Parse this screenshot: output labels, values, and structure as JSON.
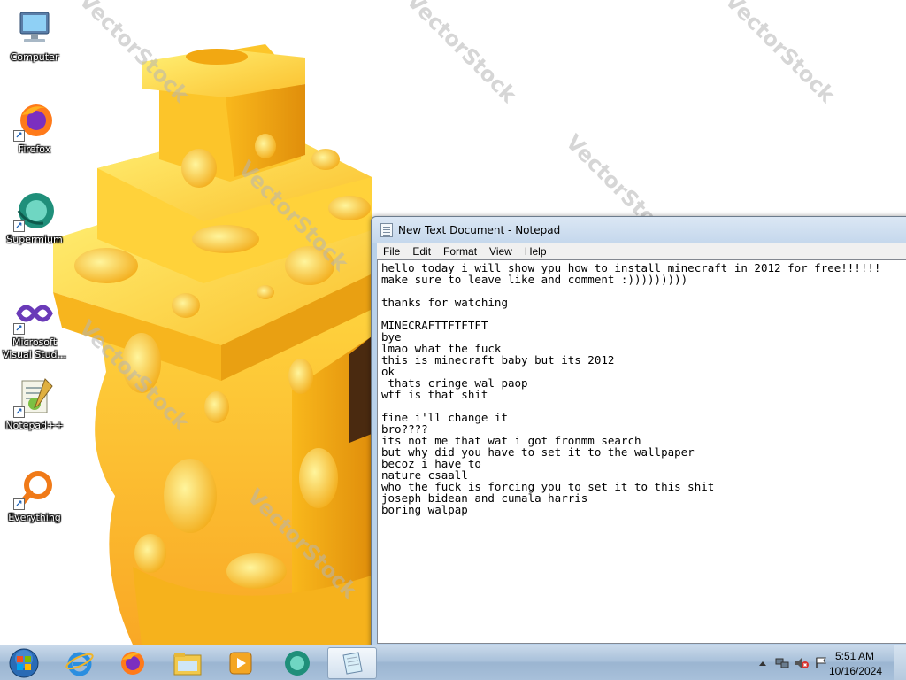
{
  "desktop": {
    "wallpaper_watermark": "VectorStock",
    "icons": [
      {
        "label": "Computer",
        "icon": "computer-icon",
        "shortcut": false
      },
      {
        "label": "Firefox",
        "icon": "firefox-icon",
        "shortcut": true
      },
      {
        "label": "Supermium",
        "icon": "supermium-icon",
        "shortcut": true
      },
      {
        "label": "Microsoft Visual Stud...",
        "icon": "visual-studio-icon",
        "shortcut": true
      },
      {
        "label": "Notepad++",
        "icon": "notepadpp-icon",
        "shortcut": true
      },
      {
        "label": "Everything",
        "icon": "everything-icon",
        "shortcut": true
      }
    ]
  },
  "notepad": {
    "title": "New Text Document - Notepad",
    "menu": [
      "File",
      "Edit",
      "Format",
      "View",
      "Help"
    ],
    "text": "hello today i will show ypu how to install minecraft in 2012 for free!!!!!!\nmake sure to leave like and comment :)))))))))\n\nthanks for watching\n\nMINECRAFTTFTFTFT\nbye\nlmao what the fuck\nthis is minecraft baby but its 2012\nok\n thats cringe wal paop\nwtf is that shit\n\nfine i'll change it\nbro????\nits not me that wat i got fronmm search\nbut why did you have to set it to the wallpaper\nbecoz i have to\nnature csaall\nwho the fuck is forcing you to set it to this shit\njoseph bidean and cumala harris\nboring walpap"
  },
  "taskbar": {
    "pinned": [
      "start-orb-icon",
      "internet-explorer-icon",
      "firefox-icon",
      "file-explorer-icon",
      "media-player-icon",
      "supermium-icon",
      "notepad-icon"
    ],
    "active": "notepad-icon",
    "clock_time": "5:51 AM",
    "clock_date": "10/16/2024"
  },
  "colors": {
    "cheese_light": "#ffe45c",
    "cheese_mid": "#f8c21c",
    "cheese_dark": "#e09a10",
    "taskbar": "#a9c1da"
  }
}
